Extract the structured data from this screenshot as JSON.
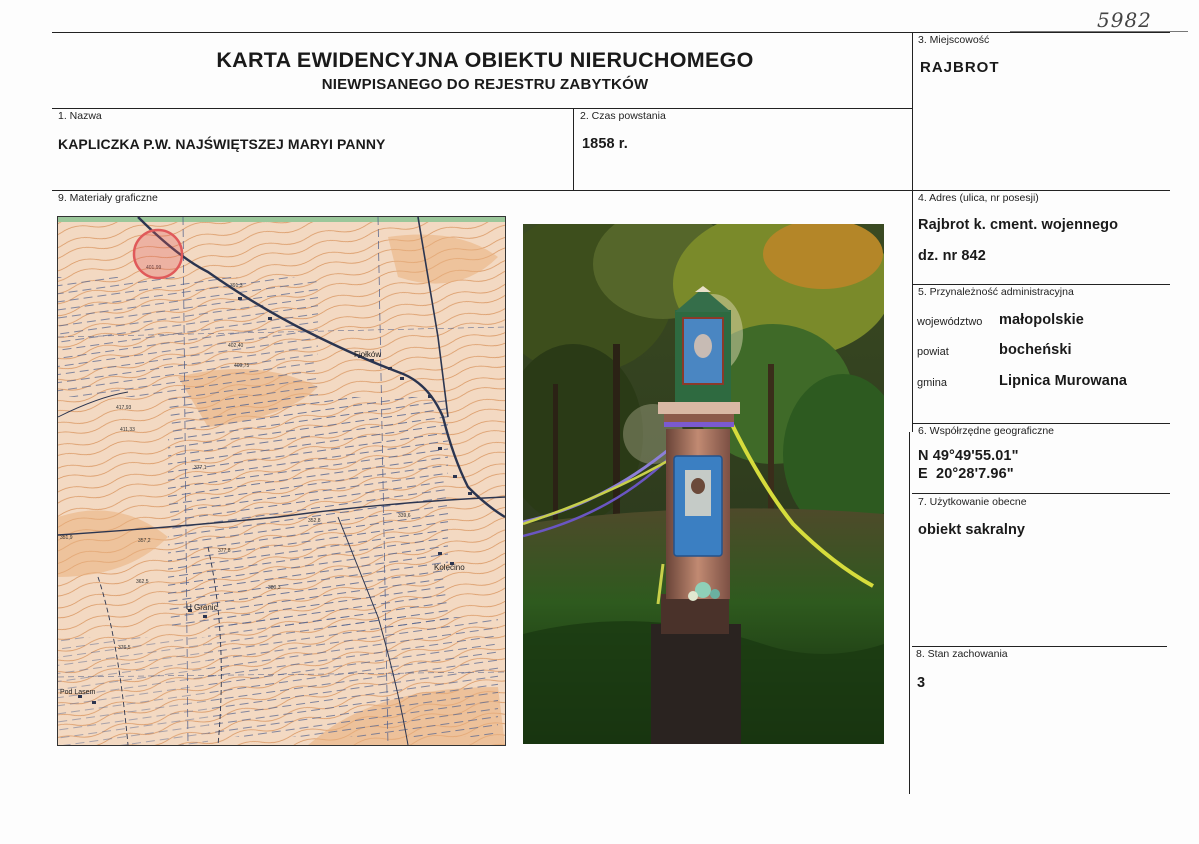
{
  "doc_number": "5982",
  "header": {
    "title": "KARTA EWIDENCYJNA OBIEKTU NIERUCHOMEGO",
    "subtitle": "NIEWPISANEGO DO REJESTRU ZABYTKÓW"
  },
  "fields": {
    "miejscowosc": {
      "label": "3. Miejscowość",
      "value": "RAJBROT"
    },
    "nazwa": {
      "label": "1. Nazwa",
      "value": "KAPLICZKA P.W. NAJŚWIĘTSZEJ MARYI PANNY"
    },
    "czas_powstania": {
      "label": "2. Czas powstania",
      "value": "1858 r."
    },
    "materialy": {
      "label": "9. Materiały graficzne"
    },
    "adres": {
      "label": "4. Adres (ulica, nr posesji)",
      "line1": "Rajbrot k. cment. wojennego",
      "line2": "dz. nr 842"
    },
    "przynaleznosc": {
      "label": "5. Przynależność administracyjna",
      "wojewodztwo_label": "województwo",
      "wojewodztwo": "małopolskie",
      "powiat_label": "powiat",
      "powiat": "bocheński",
      "gmina_label": "gmina",
      "gmina": "Lipnica Murowana"
    },
    "wspolrzedne": {
      "label": "6. Współrzędne geograficzne",
      "n": "N 49°49'55.01\"",
      "e": "E  20°28'7.96\""
    },
    "uzytkowanie": {
      "label": "7. Użytkowanie obecne",
      "value": "obiekt sakralny"
    },
    "stan": {
      "label": "8. Stan zachowania",
      "value": "3"
    }
  },
  "map": {
    "places": [
      "Fiołków",
      "U Granic",
      "Kolecino",
      "Pod Lasem"
    ],
    "elevations": [
      "401,99",
      "391,3",
      "402,40",
      "409,75",
      "417,93",
      "411,33",
      "377,1",
      "357,2",
      "362,5",
      "351,9",
      "377,8",
      "380,3",
      "339,6",
      "352,8",
      "376,5"
    ]
  },
  "colors": {
    "map_bg": "#f3d9c2",
    "contour": "#d9955f",
    "grid": "#5a6890",
    "marker": "#e05a5a"
  }
}
